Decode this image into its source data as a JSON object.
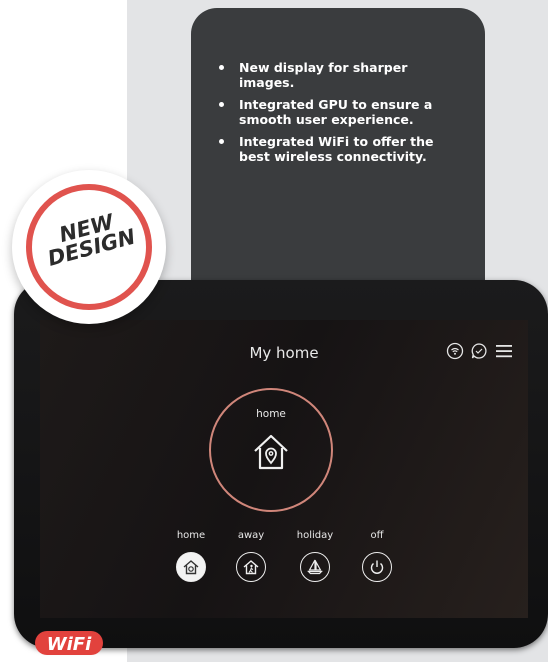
{
  "features": [
    "New display for sharper images.",
    "Integrated GPU to ensure a smooth user experience.",
    "Integrated WiFi to offer the best wireless connectivity."
  ],
  "badge": {
    "line1": "NEW",
    "line2": "DESIGN"
  },
  "screen": {
    "title": "My home",
    "current_mode": "home",
    "status_icons": [
      "wifi-icon",
      "chat-icon",
      "menu-icon"
    ],
    "modes": [
      {
        "label": "home",
        "icon": "home-icon",
        "active": true
      },
      {
        "label": "away",
        "icon": "person-leaving-icon",
        "active": false
      },
      {
        "label": "holiday",
        "icon": "sailboat-icon",
        "active": false
      },
      {
        "label": "off",
        "icon": "power-icon",
        "active": false
      }
    ]
  },
  "logo": {
    "text": "WiFi"
  },
  "colors": {
    "accent_ring": "#d0867a",
    "badge_red": "#e0534e",
    "card_bg": "#3a3c3e",
    "wifi_logo_red": "#e2423d"
  }
}
